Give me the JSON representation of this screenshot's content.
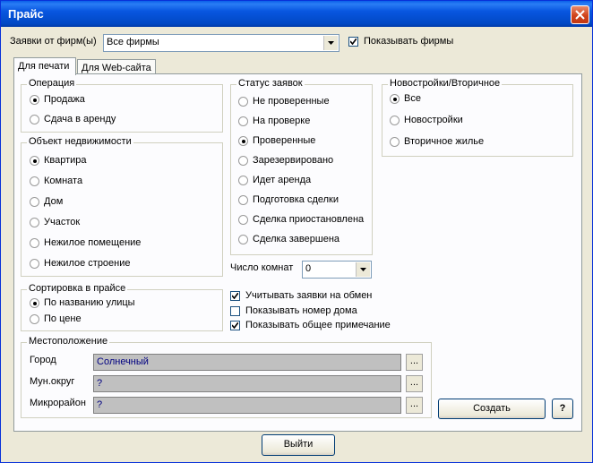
{
  "window": {
    "title": "Прайс"
  },
  "header": {
    "firms_label": "Заявки от фирм(ы)",
    "firms_value": "Все фирмы",
    "show_firms_label": "Показывать фирмы",
    "show_firms_checked": true
  },
  "tabs": [
    {
      "label": "Для печати",
      "active": true
    },
    {
      "label": "Для Web-сайта",
      "active": false
    }
  ],
  "operation": {
    "title": "Операция",
    "options": [
      {
        "label": "Продажа",
        "selected": true
      },
      {
        "label": "Сдача в аренду",
        "selected": false
      }
    ]
  },
  "object": {
    "title": "Объект недвижимости",
    "options": [
      {
        "label": "Квартира",
        "selected": true
      },
      {
        "label": "Комната",
        "selected": false
      },
      {
        "label": "Дом",
        "selected": false
      },
      {
        "label": "Участок",
        "selected": false
      },
      {
        "label": "Нежилое помещение",
        "selected": false
      },
      {
        "label": "Нежилое строение",
        "selected": false
      }
    ]
  },
  "sort": {
    "title": "Сортировка в прайсе",
    "options": [
      {
        "label": "По названию улицы",
        "selected": true
      },
      {
        "label": "По цене",
        "selected": false
      }
    ]
  },
  "status": {
    "title": "Статус заявок",
    "options": [
      {
        "label": "Не проверенные",
        "selected": false
      },
      {
        "label": "На проверке",
        "selected": false
      },
      {
        "label": "Проверенные",
        "selected": true
      },
      {
        "label": "Зарезервировано",
        "selected": false
      },
      {
        "label": "Идет аренда",
        "selected": false
      },
      {
        "label": "Подготовка сделки",
        "selected": false
      },
      {
        "label": "Сделка приостановлена",
        "selected": false
      },
      {
        "label": "Сделка завершена",
        "selected": false
      }
    ]
  },
  "newbuild": {
    "title": "Новостройки/Вторичное",
    "options": [
      {
        "label": "Все",
        "selected": true
      },
      {
        "label": "Новостройки",
        "selected": false
      },
      {
        "label": "Вторичное жилье",
        "selected": false
      }
    ]
  },
  "rooms": {
    "label": "Число комнат",
    "value": "0"
  },
  "checks": [
    {
      "label": "Учитывать заявки на обмен",
      "checked": true
    },
    {
      "label": "Показывать номер дома",
      "checked": false
    },
    {
      "label": "Показывать общее примечание",
      "checked": true
    }
  ],
  "location": {
    "title": "Местоположение",
    "city_label": "Город",
    "city_value": "Солнечный",
    "district_label": "Мун.округ",
    "district_value": "?",
    "micro_label": "Микрорайон",
    "micro_value": "?",
    "browse_label": "..."
  },
  "buttons": {
    "create": "Создать",
    "help": "?",
    "exit": "Выйти"
  },
  "colors": {
    "titlebar": "#0a5fe9",
    "panel": "#fcfcfe",
    "window": "#ece9d8",
    "field": "#c0c0c0",
    "field_text": "#000080"
  }
}
